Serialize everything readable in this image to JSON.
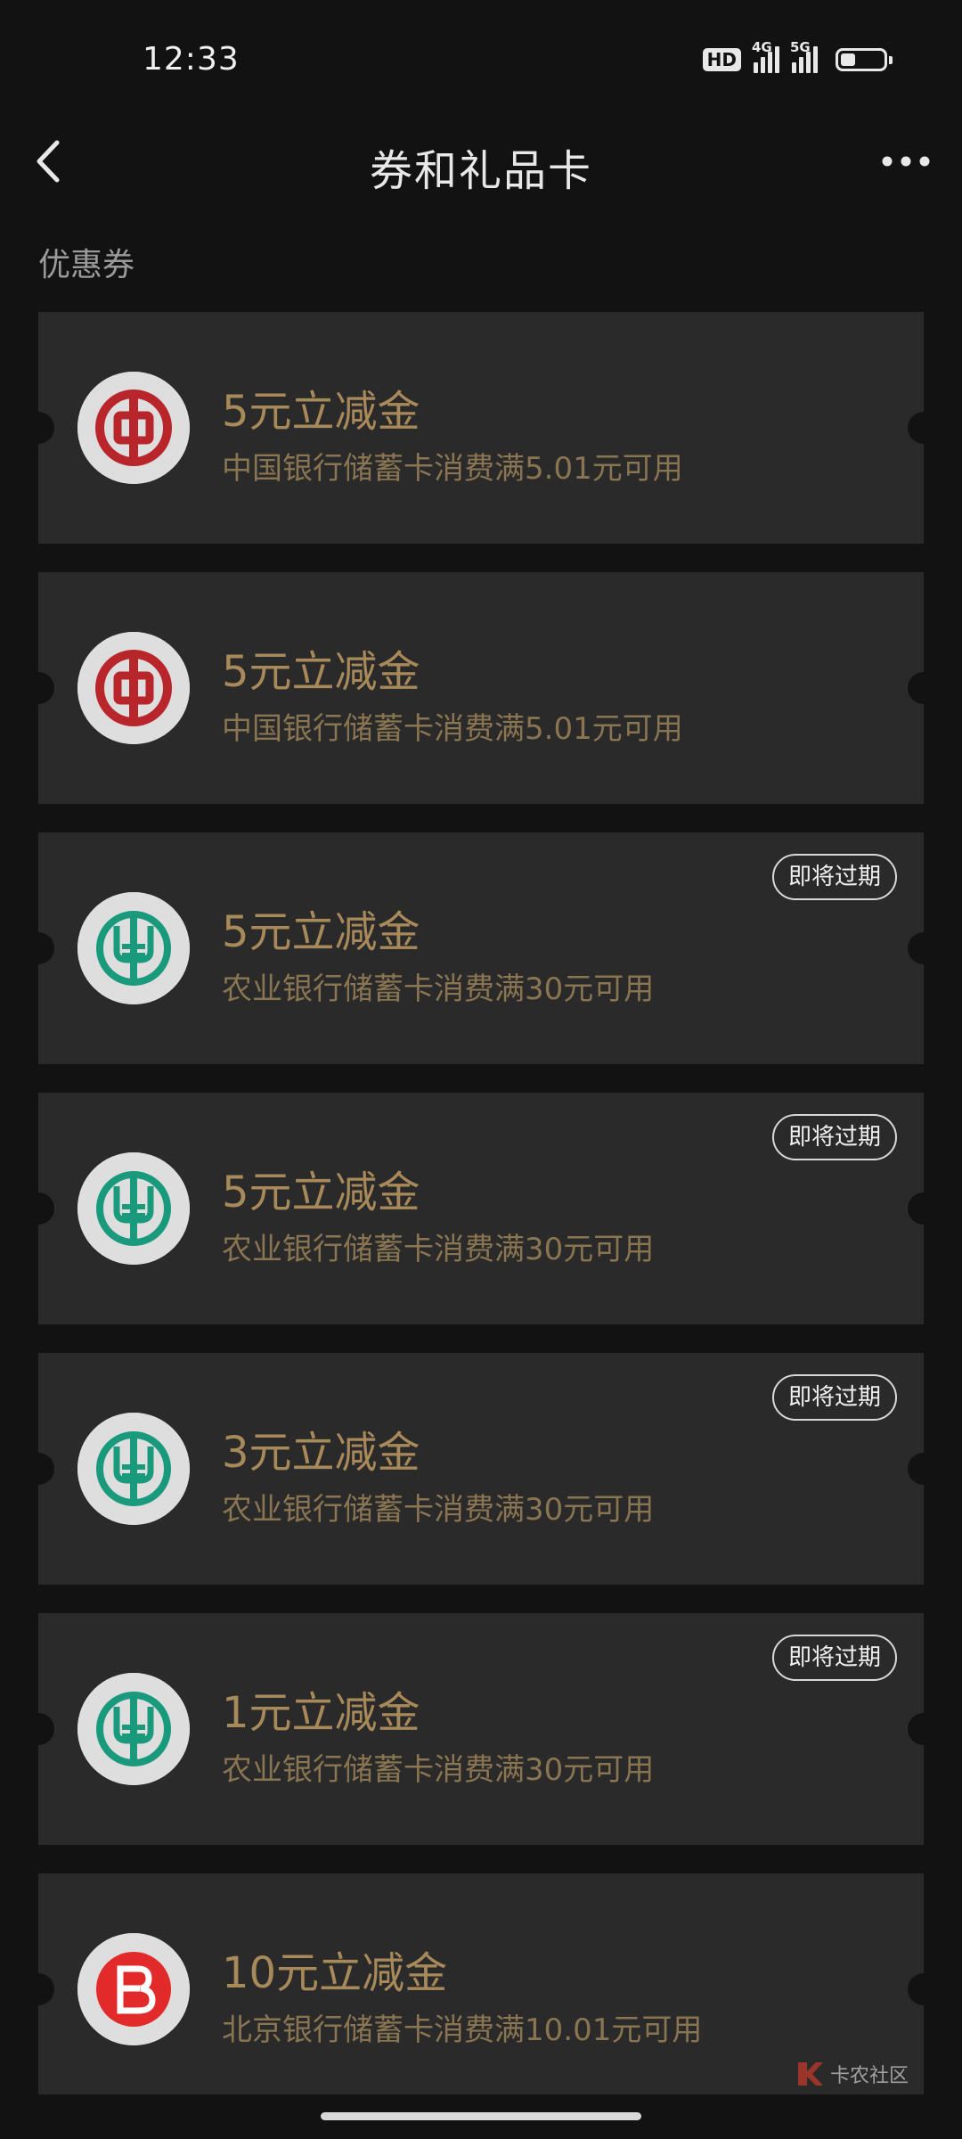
{
  "status_bar": {
    "time": "12:33",
    "hd_label": "HD",
    "net1": "4G",
    "net2": "5G",
    "battery_level_fraction": 0.25
  },
  "header": {
    "title": "券和礼品卡",
    "back_icon": "chevron-left-icon",
    "more_icon": "more-horizontal-icon"
  },
  "section": {
    "title": "优惠券"
  },
  "coupons": [
    {
      "bank": "boc",
      "amount": "5元立减金",
      "desc": "中国银行储蓄卡消费满5.01元可用",
      "badge": ""
    },
    {
      "bank": "boc",
      "amount": "5元立减金",
      "desc": "中国银行储蓄卡消费满5.01元可用",
      "badge": ""
    },
    {
      "bank": "abc",
      "amount": "5元立减金",
      "desc": "农业银行储蓄卡消费满30元可用",
      "badge": "即将过期"
    },
    {
      "bank": "abc",
      "amount": "5元立减金",
      "desc": "农业银行储蓄卡消费满30元可用",
      "badge": "即将过期"
    },
    {
      "bank": "abc",
      "amount": "3元立减金",
      "desc": "农业银行储蓄卡消费满30元可用",
      "badge": "即将过期"
    },
    {
      "bank": "abc",
      "amount": "1元立减金",
      "desc": "农业银行储蓄卡消费满30元可用",
      "badge": "即将过期"
    },
    {
      "bank": "bob",
      "amount": "10元立减金",
      "desc": "北京银行储蓄卡消费满10.01元可用",
      "badge": ""
    }
  ],
  "watermark": {
    "text": "卡农社区"
  },
  "colors": {
    "background": "#121212",
    "card": "#2a2a2a",
    "amount_text": "#a8895a",
    "desc_text": "#8a7552",
    "boc_red": "#b8262b",
    "abc_green": "#1a9a7c",
    "bob_red": "#e32a2a"
  }
}
